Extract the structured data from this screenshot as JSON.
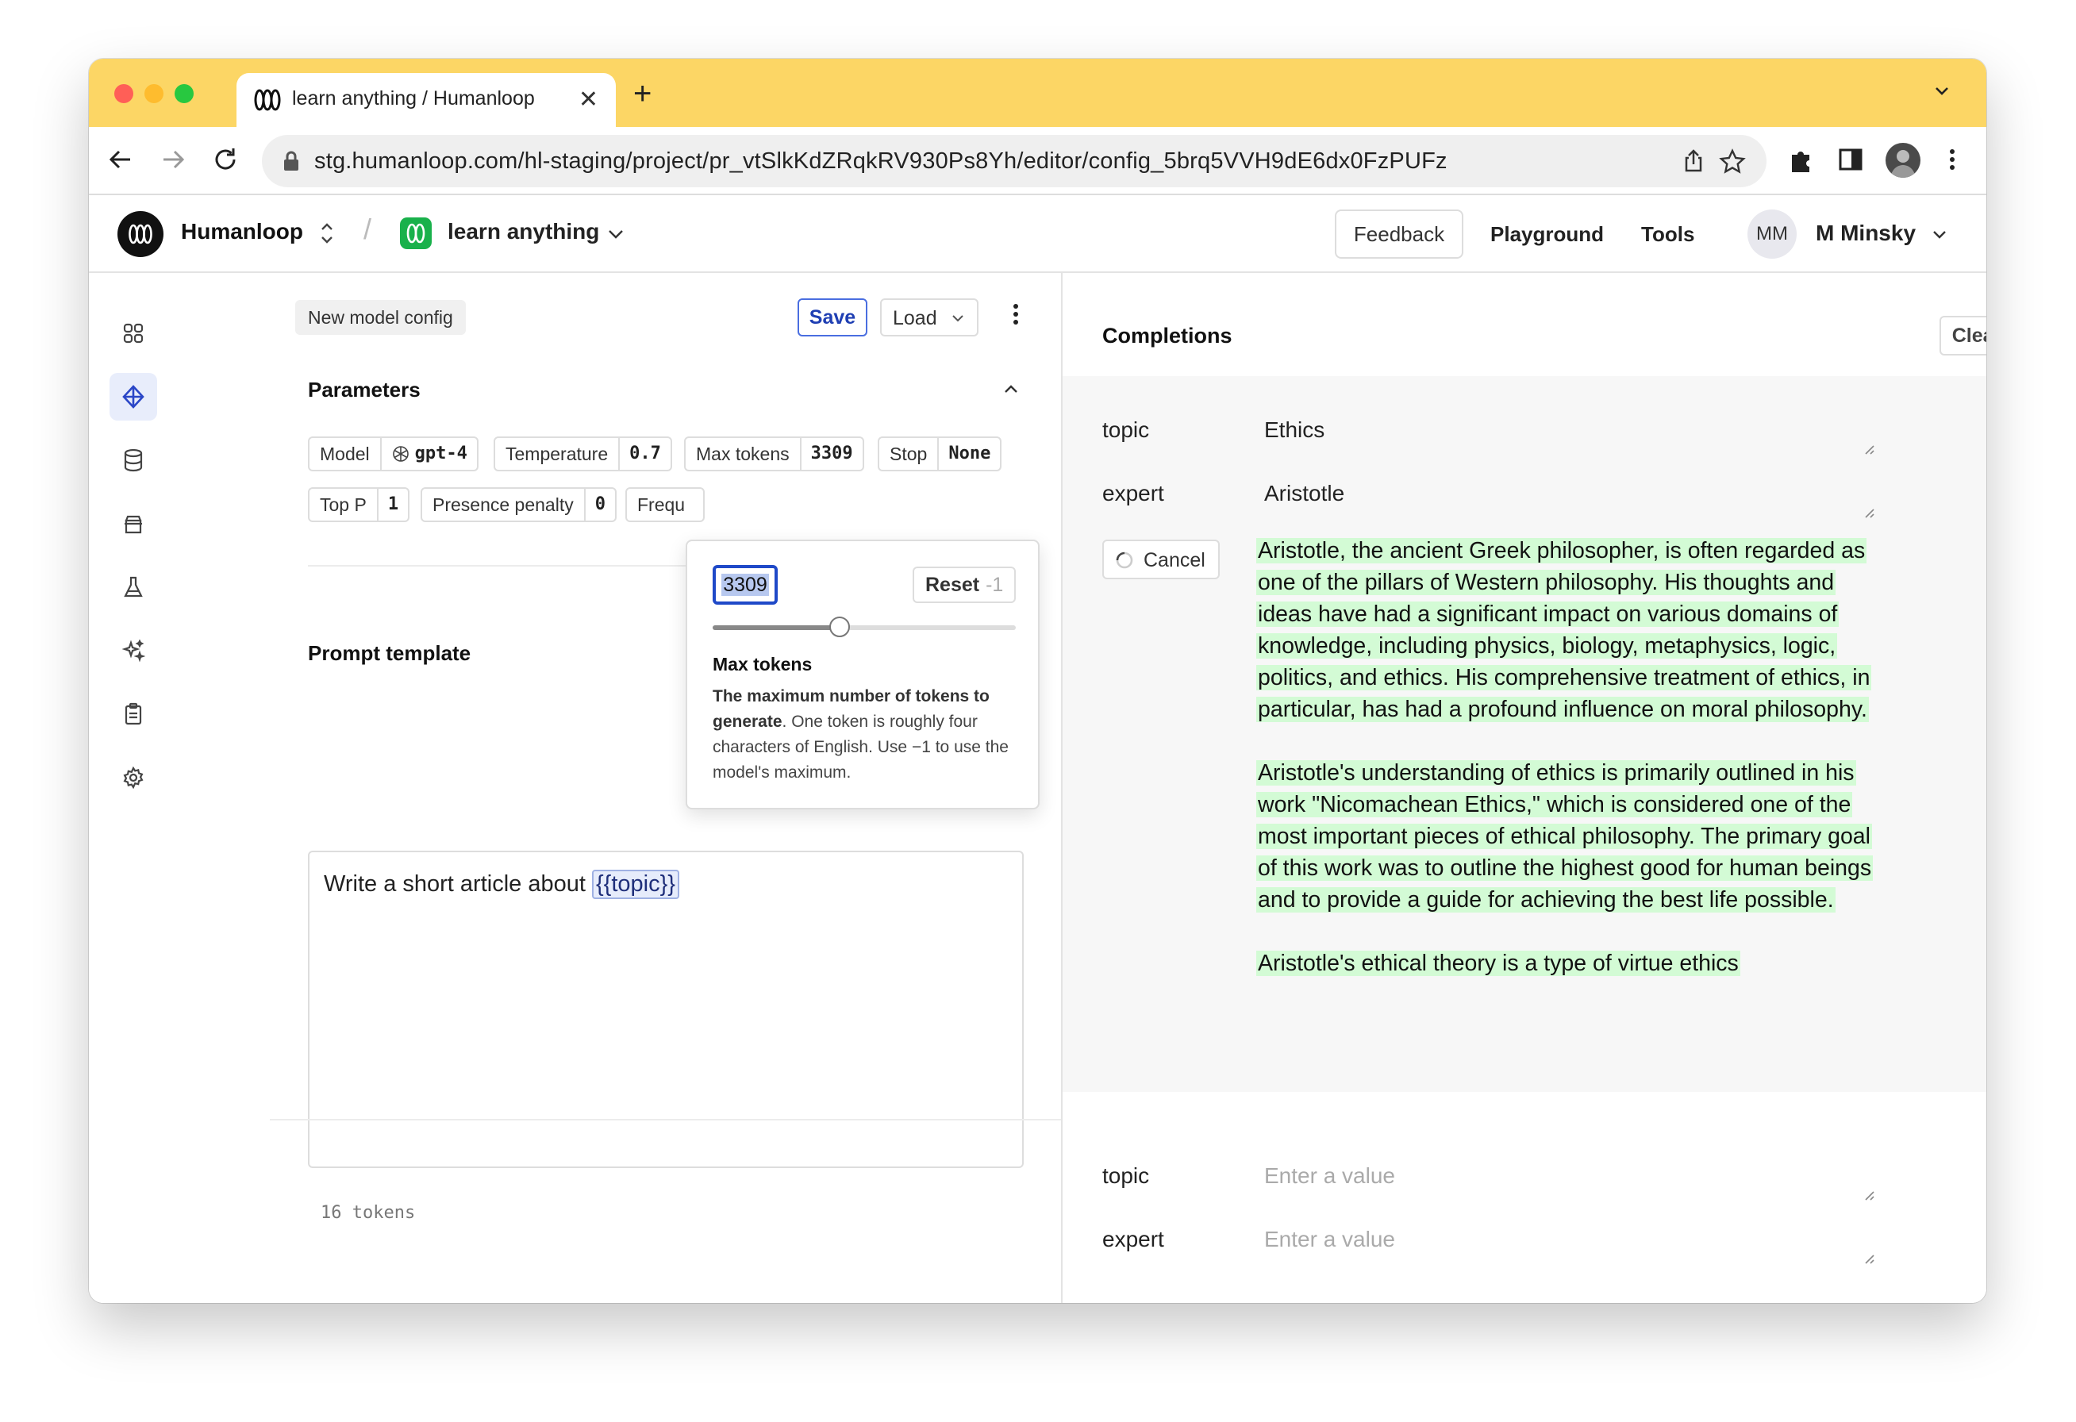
{
  "browser": {
    "tab_title": "learn anything / Humanloop",
    "url": "stg.humanloop.com/hl-staging/project/pr_vtSlkKdZRqkRV930Ps8Yh/editor/config_5brq5VVH9dE6dx0FzPUFz",
    "colors": {
      "tabstrip": "#fcd665",
      "close": "#ff5f57",
      "minimize": "#febc2e",
      "zoom": "#28c840"
    }
  },
  "header": {
    "brand": "Humanloop",
    "project": "learn anything",
    "feedback": "Feedback",
    "playground": "Playground",
    "tools": "Tools",
    "user_initials": "MM",
    "user_name": "M Minsky"
  },
  "sidebar": {
    "items": [
      "grid-icon",
      "editor-icon",
      "database-icon",
      "archive-icon",
      "flask-icon",
      "sparkle-icon",
      "clipboard-icon",
      "settings-icon"
    ],
    "active": "editor-icon"
  },
  "editor": {
    "config_name": "New model config",
    "save": "Save",
    "load": "Load",
    "parameters_title": "Parameters",
    "params": {
      "model_label": "Model",
      "model_value": "gpt-4",
      "temperature_label": "Temperature",
      "temperature_value": "0.7",
      "max_tokens_label": "Max tokens",
      "max_tokens_value": "3309",
      "stop_label": "Stop",
      "stop_value": "None",
      "top_p_label": "Top P",
      "top_p_value": "1",
      "presence_label": "Presence penalty",
      "presence_value": "0",
      "frequency_label": "Frequ"
    },
    "prompt_title": "Prompt template",
    "prompt_text": "Write a short article about ",
    "prompt_var": "{{topic}}",
    "tokens": "16 tokens"
  },
  "popover": {
    "value": "3309",
    "reset": "Reset",
    "reset_value": "-1",
    "slider_fraction": 0.42,
    "title": "Max tokens",
    "desc_bold": "The maximum number of tokens to generate",
    "desc_rest": ". One token is roughly four characters of English. Use −1 to use the model's maximum."
  },
  "completions": {
    "title": "Completions",
    "clear": "Clear",
    "row1": {
      "key1": "topic",
      "val1": "Ethics",
      "key2": "expert",
      "val2": "Aristotle"
    },
    "cancel": "Cancel",
    "paragraphs": [
      "Aristotle, the ancient Greek philosopher, is often regarded as one of the pillars of Western philosophy. His thoughts and ideas have had a significant impact on various domains of knowledge, including physics, biology, metaphysics, logic, politics, and ethics. His comprehensive treatment of ethics, in particular, has had a profound influence on moral philosophy.",
      "Aristotle's understanding of ethics is primarily outlined in his work \"Nicomachean Ethics,\" which is considered one of the most important pieces of ethical philosophy. The primary goal of this work was to outline the highest good for human beings and to provide a guide for achieving the best life possible.",
      "Aristotle's ethical theory is a type of virtue ethics"
    ],
    "row2": {
      "key1": "topic",
      "ph1": "Enter a value",
      "key2": "expert",
      "ph2": "Enter a value"
    },
    "highlight_color": "#d3fbd5"
  }
}
